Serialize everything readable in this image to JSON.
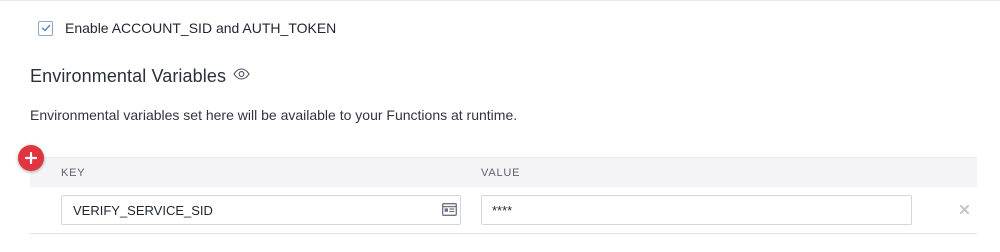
{
  "settings": {
    "enable_credentials": {
      "label": "Enable ACCOUNT_SID and AUTH_TOKEN",
      "checked": true
    }
  },
  "env_section": {
    "title": "Environmental Variables",
    "visibility_icon": "eye-icon",
    "description": "Environmental variables set here will be available to your Functions at runtime."
  },
  "env_table": {
    "columns": {
      "key": "KEY",
      "value": "VALUE"
    },
    "rows": [
      {
        "key": "VERIFY_SERVICE_SID",
        "value": "****"
      }
    ],
    "add_icon": "plus-circle-icon",
    "remove_icon": "close-icon",
    "key_field_icon": "contact-card-icon"
  },
  "colors": {
    "add_button": "#e0353f",
    "checkbox_check": "#4b7ac6",
    "header_bg": "#f4f4f6"
  }
}
